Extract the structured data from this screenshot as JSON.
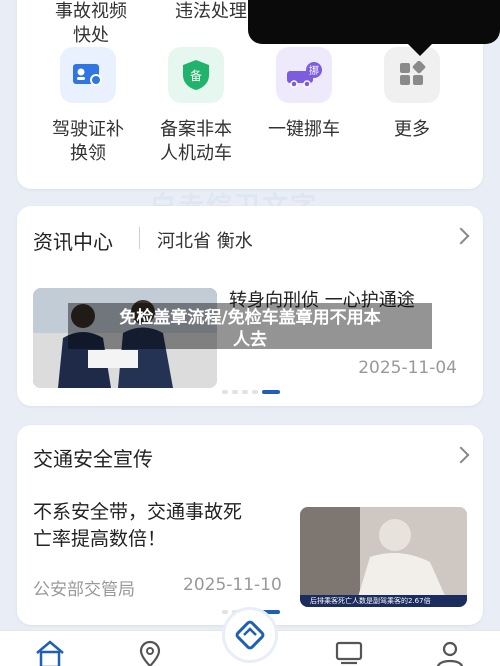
{
  "services_row1": [
    {
      "label": "事故视频\n快处"
    },
    {
      "label": "违法处理"
    }
  ],
  "services_row2": [
    {
      "label_line1": "驾驶证补",
      "label_line2": "换领",
      "icon": "license-icon",
      "bg": "#e8f1fd",
      "fg": "#2f76e0"
    },
    {
      "label_line1": "备案非本",
      "label_line2": "人机动车",
      "icon": "record-shield-icon",
      "bg": "#e6f7ef",
      "fg": "#21b36b"
    },
    {
      "label_line1": "一键挪车",
      "label_line2": "",
      "icon": "move-car-icon",
      "bg": "#eeeafc",
      "fg": "#7c5ce0"
    },
    {
      "label_line1": "更多",
      "label_line2": "",
      "icon": "more-grid-icon",
      "bg": "#f0f0f0",
      "fg": "#8a8a8a"
    }
  ],
  "watermark": "白赤综卫文字",
  "news": {
    "title": "资讯中心",
    "region": "河北省 衡水",
    "headline": "转身向刑侦 一心护通途",
    "date": "2025-11-04",
    "overlay_title_line1": "免检盖章流程/免检车盖章用不用本",
    "overlay_title_line2": "人去"
  },
  "traffic": {
    "title": "交通安全宣传",
    "headline_line1": "不系安全带，交通事故死",
    "headline_line2": "亡率提高数倍！",
    "source": "公安部交管局",
    "date": "2025-11-10",
    "image_caption": "后排乘客死亡人数是副驾乘客的2.67倍"
  },
  "colors": {
    "accent": "#1f5fb6",
    "page_bg": "#e9eef6"
  }
}
